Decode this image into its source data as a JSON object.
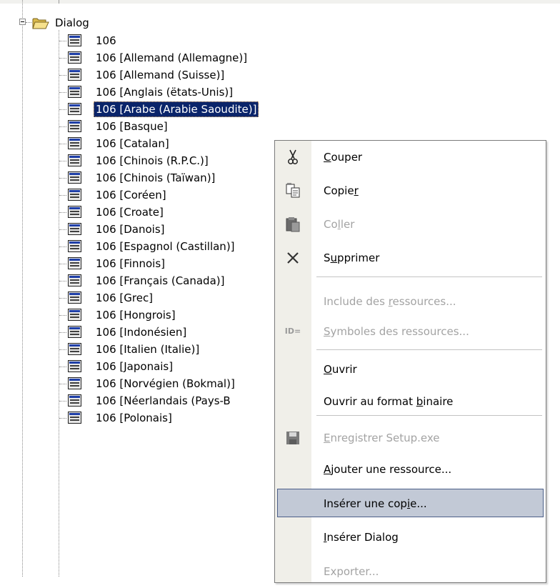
{
  "tree": {
    "root_label": "Dialog",
    "items": [
      "106",
      "106 [Allemand (Allemagne)]",
      "106 [Allemand (Suisse)]",
      "106 [Anglais (ëtats-Unis)]",
      "106 [Arabe (Arabie Saoudite)]",
      "106 [Basque]",
      "106 [Catalan]",
      "106 [Chinois (R.P.C.)]",
      "106 [Chinois (Taïwan)]",
      "106 [Coréen]",
      "106 [Croate]",
      "106 [Danois]",
      "106 [Espagnol (Castillan)]",
      "106 [Finnois]",
      "106 [Français (Canada)]",
      "106 [Grec]",
      "106 [Hongrois]",
      "106 [Indonésien]",
      "106 [Italien (Italie)]",
      "106 [Japonais]",
      "106 [Norvégien (Bokmal)]",
      "106 [Néerlandais (Pays-B",
      "106 [Polonais]"
    ],
    "selected_index": 4
  },
  "context_menu": {
    "items": [
      {
        "pre": "",
        "u": "C",
        "post": "ouper",
        "icon": "scissors-icon",
        "enabled": true
      },
      {
        "pre": "Copie",
        "u": "r",
        "post": "",
        "icon": "copy-icon",
        "enabled": true
      },
      {
        "pre": "Co",
        "u": "l",
        "post": "ler",
        "icon": "paste-icon",
        "enabled": false
      },
      {
        "pre": "S",
        "u": "u",
        "post": "pprimer",
        "icon": "delete-icon",
        "enabled": true
      },
      {
        "pre": "Include des ",
        "u": "r",
        "post": "essources...",
        "icon": "",
        "enabled": false
      },
      {
        "pre": "",
        "u": "S",
        "post": "ymboles des ressources...",
        "icon": "resource-symbols-icon",
        "enabled": false
      },
      {
        "pre": "",
        "u": "O",
        "post": "uvrir",
        "icon": "",
        "enabled": true
      },
      {
        "pre": "Ouvrir au format ",
        "u": "b",
        "post": "inaire",
        "icon": "",
        "enabled": true
      },
      {
        "pre": "",
        "u": "E",
        "post": "nregistrer Setup.exe",
        "icon": "save-icon",
        "enabled": false
      },
      {
        "pre": "",
        "u": "A",
        "post": "jouter une ressource...",
        "icon": "",
        "enabled": true
      },
      {
        "pre": "Insérer une cop",
        "u": "i",
        "post": "e...",
        "icon": "",
        "enabled": true
      },
      {
        "pre": "",
        "u": "I",
        "post": "nsérer Dialog",
        "icon": "",
        "enabled": true
      },
      {
        "pre": "Exporter...",
        "u": "",
        "post": "",
        "icon": "",
        "enabled": false
      }
    ],
    "hovered_index": 10,
    "id_icon_text": "ID="
  },
  "colors": {
    "selection_bg": "#0a246a",
    "menu_hover_bg": "#c2c9d6",
    "menu_hover_border": "#4b5e88",
    "disabled_text": "#a3a3a3",
    "menu_gutter": "#f0efe9"
  }
}
